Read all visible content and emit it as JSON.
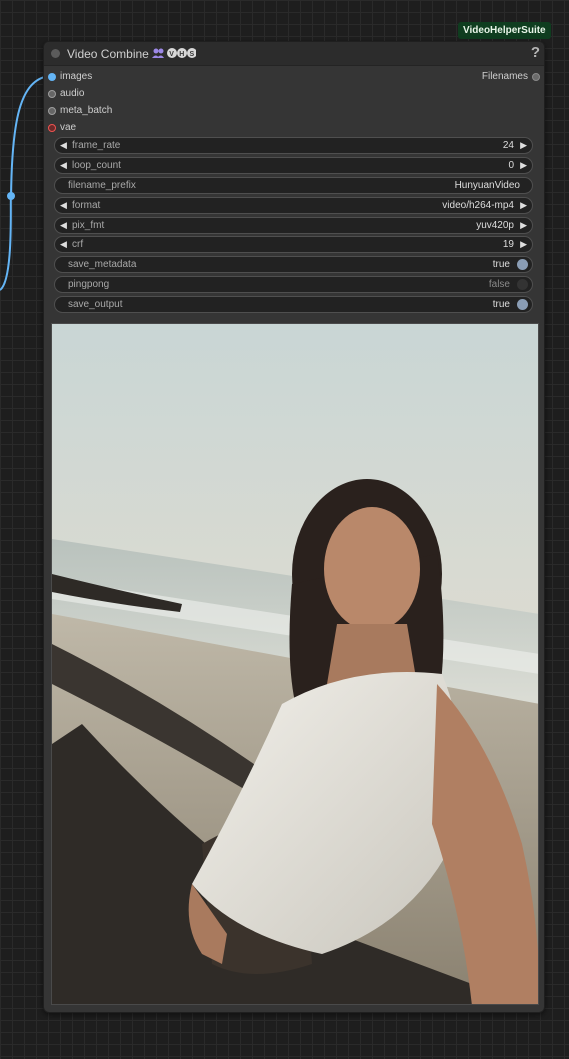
{
  "group_badge": "VideoHelperSuite",
  "node": {
    "title": "Video Combine",
    "icon": "vhs-logo-icon",
    "help": "?"
  },
  "inputs": [
    {
      "label": "images",
      "color": "#64b5f6",
      "connected": true
    },
    {
      "label": "audio",
      "color": "#9e9e9e",
      "connected": false
    },
    {
      "label": "meta_batch",
      "color": "#9e9e9e",
      "connected": false
    },
    {
      "label": "vae",
      "color": "#ef5350",
      "connected": false
    }
  ],
  "outputs": [
    {
      "label": "Filenames"
    }
  ],
  "widgets": [
    {
      "name": "frame_rate",
      "value": "24",
      "kind": "number"
    },
    {
      "name": "loop_count",
      "value": "0",
      "kind": "number"
    },
    {
      "name": "filename_prefix",
      "value": "HunyuanVideo",
      "kind": "text"
    },
    {
      "name": "format",
      "value": "video/h264-mp4",
      "kind": "combo"
    },
    {
      "name": "pix_fmt",
      "value": "yuv420p",
      "kind": "combo"
    },
    {
      "name": "crf",
      "value": "19",
      "kind": "number"
    },
    {
      "name": "save_metadata",
      "value": "true",
      "kind": "toggle"
    },
    {
      "name": "pingpong",
      "value": "false",
      "kind": "toggle"
    },
    {
      "name": "save_output",
      "value": "true",
      "kind": "toggle"
    }
  ],
  "preview": {
    "subject": "woman-in-white-dress-selfie-on-beach-preview"
  },
  "colors": {
    "link": "#64b5f6",
    "badge_bg": "#0f3d1f",
    "toggle_on": "#8a9db5"
  }
}
